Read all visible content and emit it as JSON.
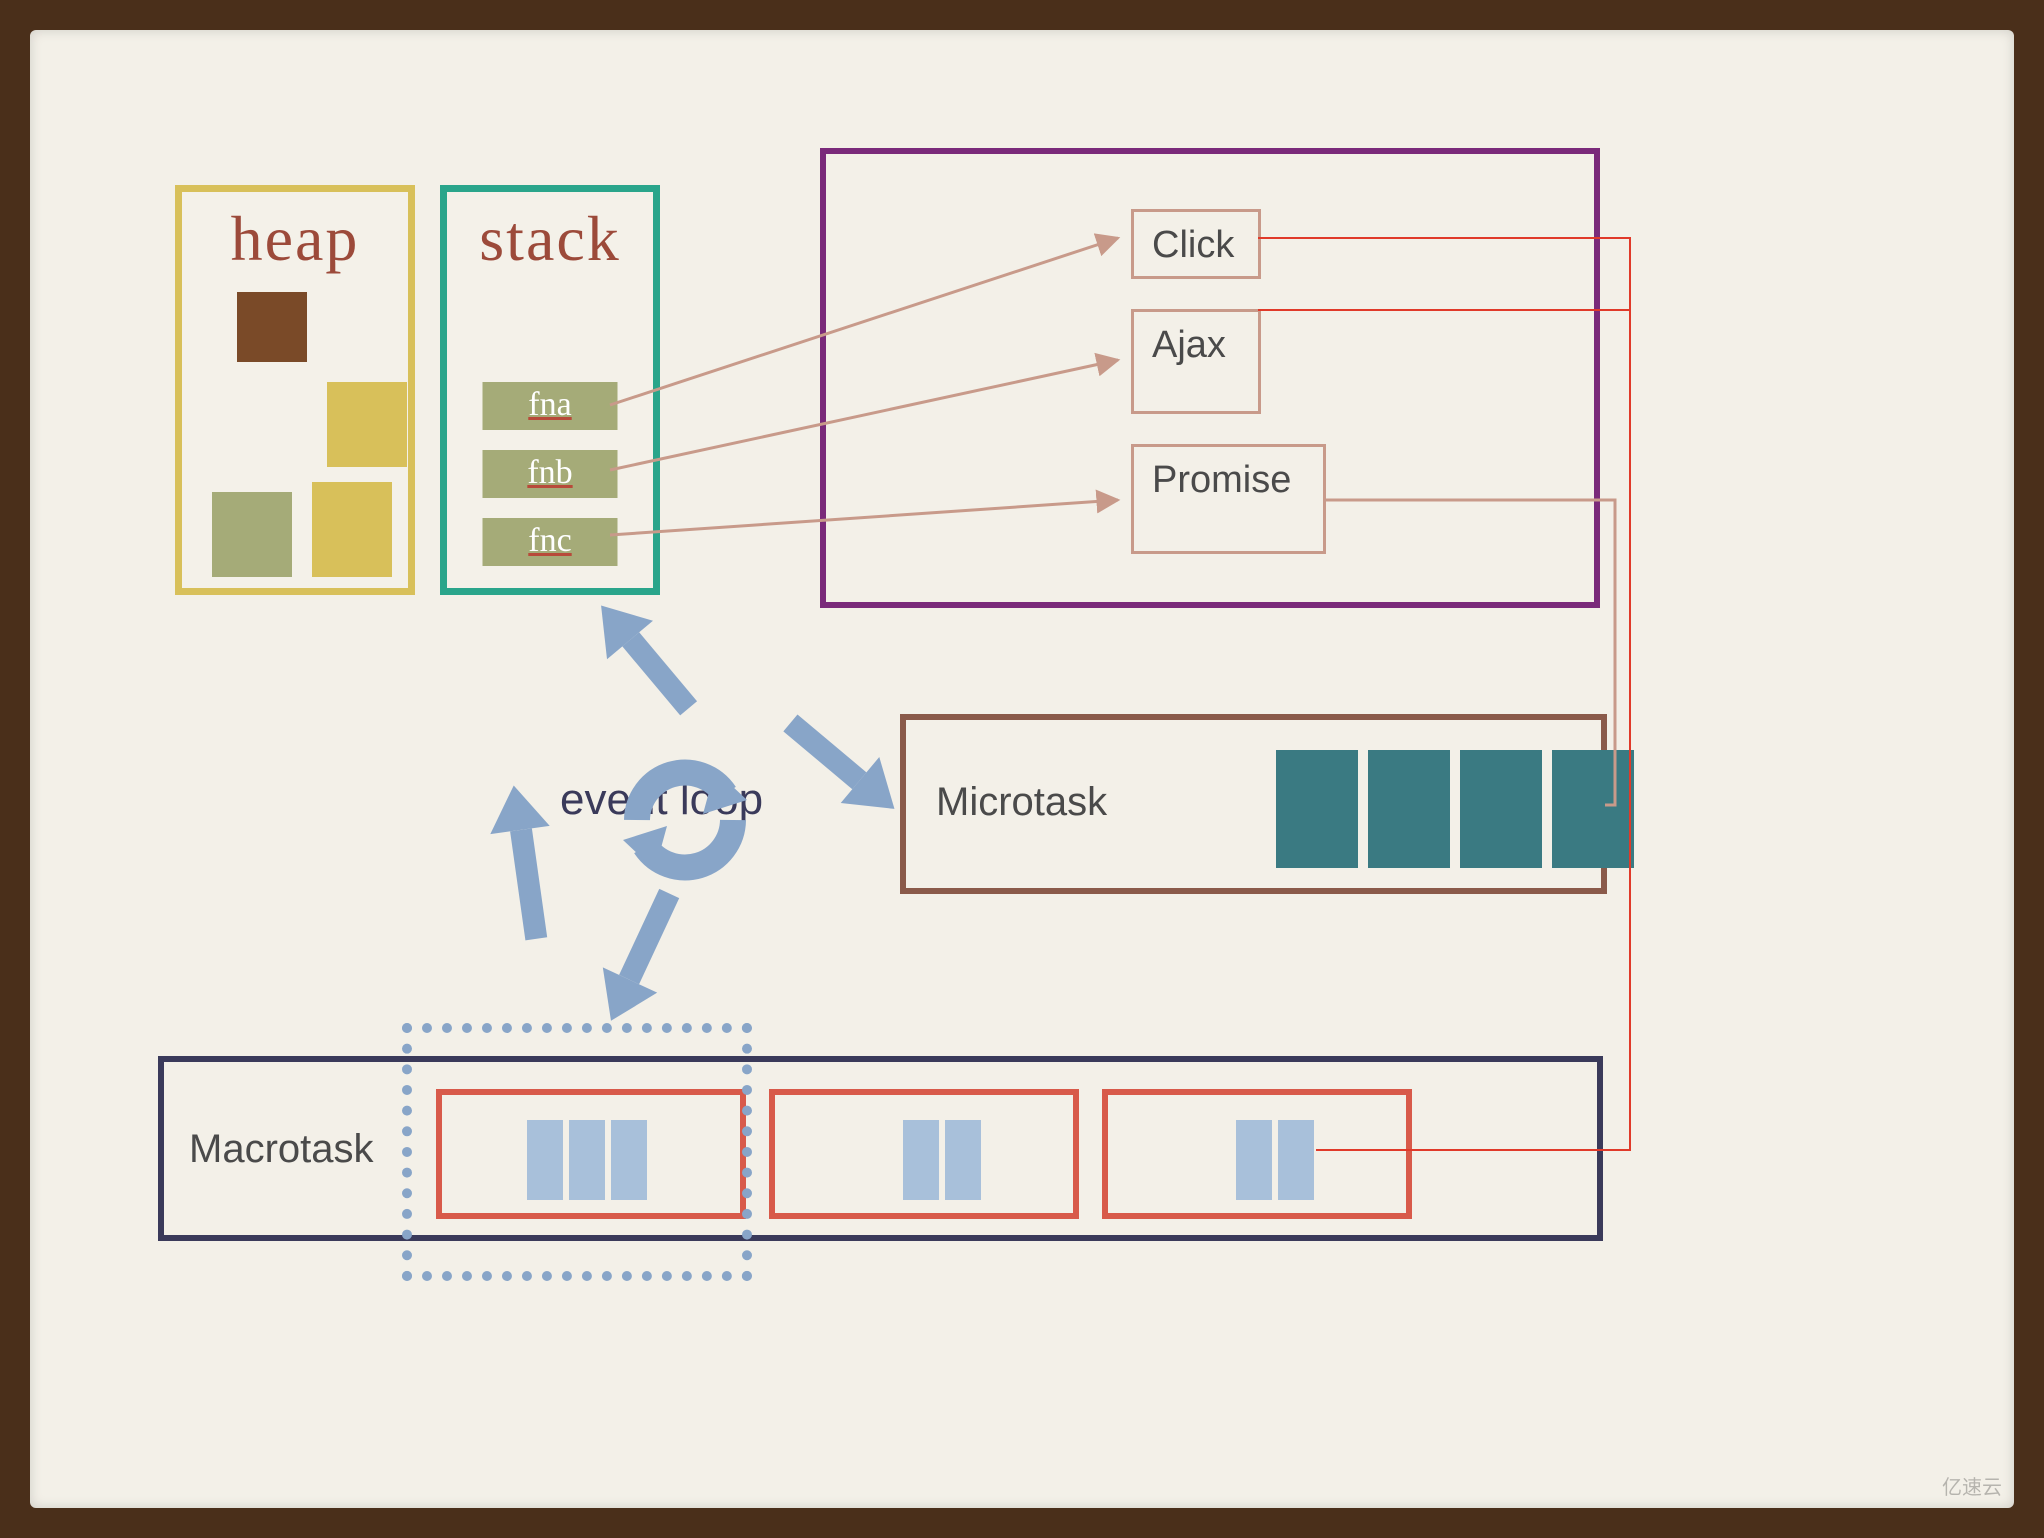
{
  "heap": {
    "title": "heap"
  },
  "stack": {
    "title": "stack",
    "items": [
      "fna",
      "fnb",
      "fnc"
    ]
  },
  "webapis": {
    "items": [
      "Click",
      "Ajax",
      "Promise"
    ]
  },
  "microtask": {
    "label": "Microtask",
    "block_count": 4
  },
  "macrotask": {
    "label": "Macrotask",
    "groups": [
      {
        "bars": 3
      },
      {
        "bars": 2
      },
      {
        "bars": 2
      }
    ]
  },
  "eventloop": {
    "label": "event loop"
  },
  "colors": {
    "heap_border": "#d8c05a",
    "stack_border": "#2aa58b",
    "webapis_border": "#7a2a7a",
    "microtask_border": "#8a5a4a",
    "macrotask_border": "#3a3a5a",
    "macro_group_border": "#d85a4a",
    "arrow_blue": "#88a5c8",
    "arrow_brown": "#c89a8a",
    "line_red": "#e03a2a"
  },
  "watermark": "亿速云"
}
